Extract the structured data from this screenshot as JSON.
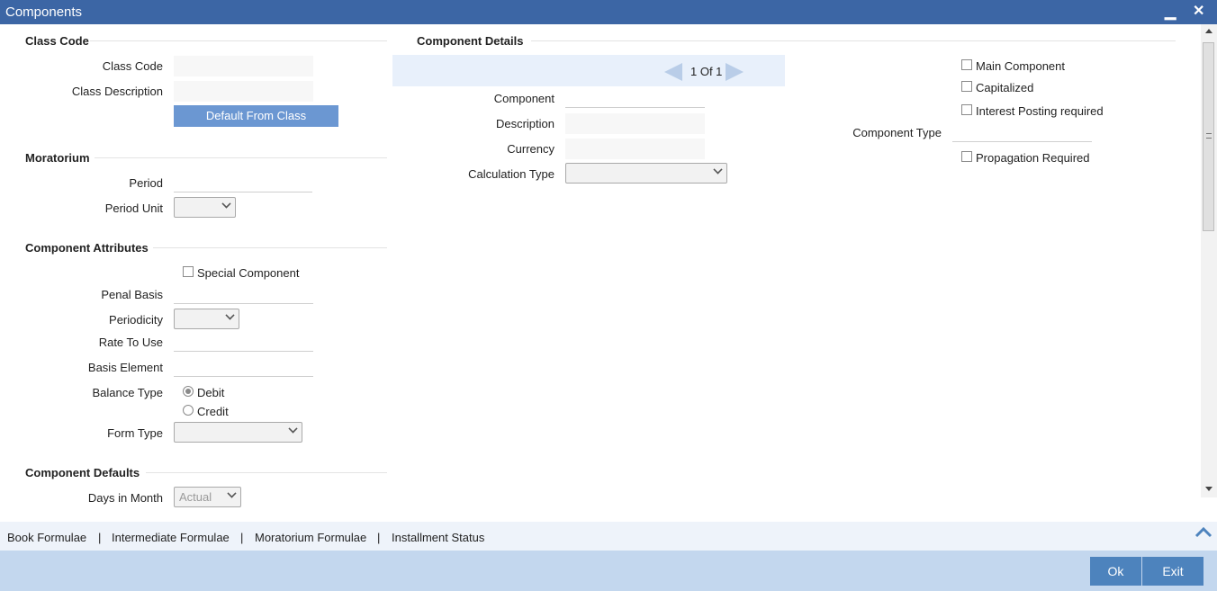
{
  "window": {
    "title": "Components",
    "minimize_glyph": "▁",
    "close_glyph": "✕"
  },
  "class_code": {
    "heading": "Class Code",
    "class_code_label": "Class Code",
    "class_code_value": "",
    "class_description_label": "Class Description",
    "class_description_value": "",
    "default_button": "Default From Class"
  },
  "moratorium": {
    "heading": "Moratorium",
    "period_label": "Period",
    "period_value": "",
    "period_unit_label": "Period Unit",
    "period_unit_value": ""
  },
  "component_attributes": {
    "heading": "Component Attributes",
    "special_component_label": "Special Component",
    "penal_basis_label": "Penal Basis",
    "periodicity_label": "Periodicity",
    "rate_to_use_label": "Rate To Use",
    "basis_element_label": "Basis Element",
    "balance_type_label": "Balance Type",
    "balance_options": [
      "Debit",
      "Credit"
    ],
    "form_type_label": "Form Type"
  },
  "component_defaults": {
    "heading": "Component Defaults",
    "days_in_month_label": "Days in Month",
    "days_in_month_value": "Actual"
  },
  "component_details": {
    "heading": "Component Details",
    "pager_text": "1 Of 1",
    "component_label": "Component",
    "description_label": "Description",
    "currency_label": "Currency",
    "calculation_type_label": "Calculation Type",
    "component_type_label": "Component Type",
    "main_component_label": "Main Component",
    "capitalized_label": "Capitalized",
    "interest_posting_label": "Interest Posting required",
    "propagation_label": "Propagation Required"
  },
  "links": [
    "Book Formulae",
    "Intermediate Formulae",
    "Moratorium Formulae",
    "Installment Status"
  ],
  "link_separator": "|",
  "footer": {
    "ok": "Ok",
    "exit": "Exit"
  },
  "colors": {
    "titlebar": "#3c66a5",
    "button": "#4d83bd",
    "footer": "#c3d7ee"
  },
  "icons": {
    "collapse": "chevron-up-icon",
    "pager_prev": "arrow-left-icon",
    "pager_next": "arrow-right-icon"
  }
}
